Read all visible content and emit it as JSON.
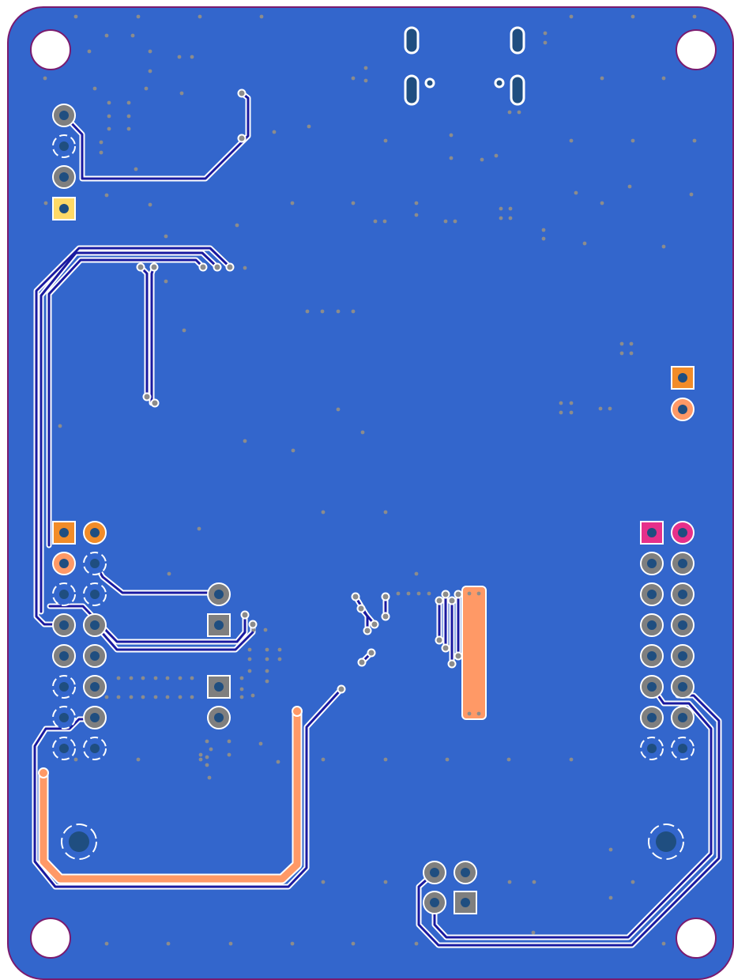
{
  "view": {
    "name": "pcb-bottom-layer",
    "colors": {
      "background": "#ffffff",
      "copper_pour": "#3366cc",
      "trace_outline": "#ffffff",
      "trace": "#1a1aa0",
      "board_outline": "#7a1a6e",
      "via": "#8c8c8c",
      "pad_plated": "#7f7f7f",
      "pad_hole": "#1f4e80",
      "power_trace": "#ff9966",
      "pad_orange": "#f28c28",
      "pad_salmon": "#ff9966",
      "pad_magenta": "#e6308a",
      "pad_yellow": "#ffd966",
      "mounting_hole": "#ffffff"
    }
  }
}
